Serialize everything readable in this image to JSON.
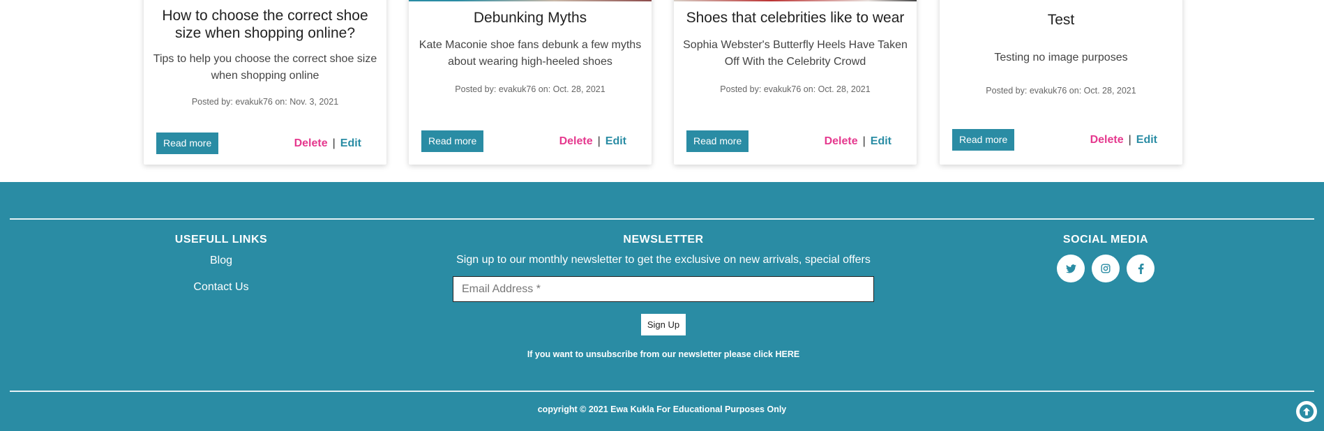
{
  "posts": [
    {
      "title": "How to choose the correct shoe size when shopping online?",
      "excerpt": "Tips to help you choose the correct shoe size when shopping online",
      "meta": "Posted by: evakuk76 on: Nov. 3, 2021",
      "read_more": "Read more",
      "delete": "Delete",
      "separator": "|",
      "edit": "Edit"
    },
    {
      "title": "Debunking Myths",
      "excerpt": "Kate Maconie shoe fans debunk a few myths about wearing high-heeled shoes",
      "meta": "Posted by: evakuk76 on: Oct. 28, 2021",
      "read_more": "Read more",
      "delete": "Delete",
      "separator": "|",
      "edit": "Edit"
    },
    {
      "title": "Shoes that celebrities like to wear",
      "excerpt": "Sophia Webster's Butterfly Heels Have Taken Off With the Celebrity Crowd",
      "meta": "Posted by: evakuk76 on: Oct. 28, 2021",
      "read_more": "Read more",
      "delete": "Delete",
      "separator": "|",
      "edit": "Edit"
    },
    {
      "title": "Test",
      "excerpt": "Testing no image purposes",
      "meta": "Posted by: evakuk76 on: Oct. 28, 2021",
      "read_more": "Read more",
      "delete": "Delete",
      "separator": "|",
      "edit": "Edit"
    }
  ],
  "footer": {
    "links_title": "USEFULL LINKS",
    "links": [
      "Blog",
      "Contact Us"
    ],
    "newsletter_title": "NEWSLETTER",
    "newsletter_desc": "Sign up to our monthly newsletter to get the exclusive on new arrivals, special offers",
    "email_placeholder": "Email Address *",
    "signup_label": "Sign Up",
    "unsubscribe_text": "If you want to unsubscribe from our newsletter please click ",
    "unsubscribe_link": "HERE",
    "social_title": "SOCIAL MEDIA",
    "social_icons": [
      "twitter-icon",
      "instagram-icon",
      "facebook-icon"
    ],
    "copyright": "copyright © 2021 Ewa Kukla For Educational Purposes Only"
  },
  "colors": {
    "primary": "#2a8ca4",
    "delete": "#e5398e",
    "footer_text": "#ffffff"
  }
}
